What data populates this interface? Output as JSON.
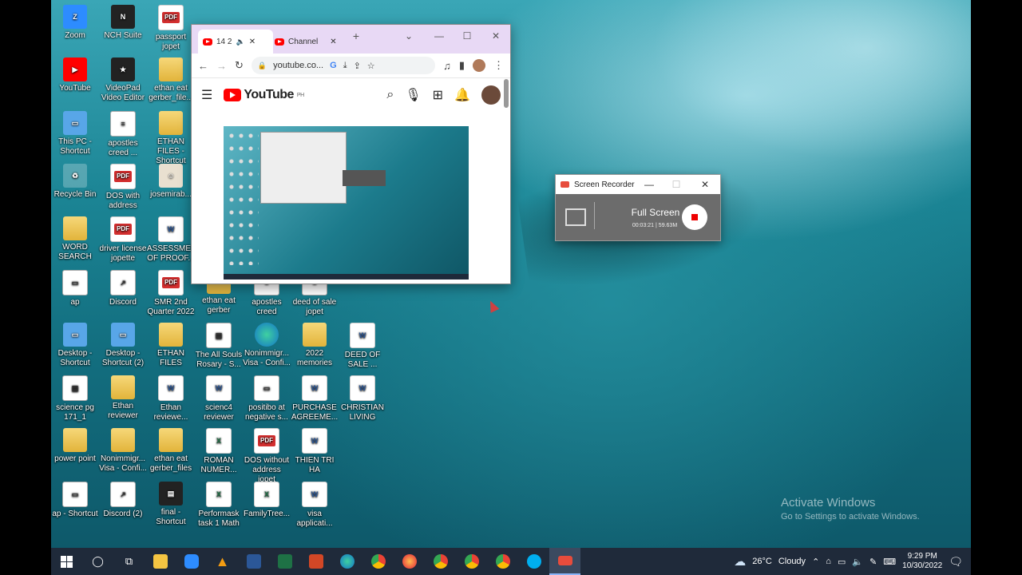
{
  "desktop": {
    "icons": [
      {
        "label": "Zoom",
        "x": 0,
        "y": 0,
        "type": "app",
        "glyph": "Z"
      },
      {
        "label": "NCH Suite",
        "x": 1,
        "y": 0,
        "type": "dark",
        "glyph": "N"
      },
      {
        "label": "passport jopet",
        "x": 2,
        "y": 0,
        "type": "pdf",
        "glyph": "PDF"
      },
      {
        "label": "YouTube",
        "x": 0,
        "y": 1,
        "type": "yt",
        "glyph": "▶"
      },
      {
        "label": "VideoPad Video Editor",
        "x": 1,
        "y": 1,
        "type": "dark",
        "glyph": "★"
      },
      {
        "label": "ethan eat gerber_file...",
        "x": 2,
        "y": 1,
        "type": "folder",
        "glyph": ""
      },
      {
        "label": "This PC - Shortcut",
        "x": 0,
        "y": 2,
        "type": "pc",
        "glyph": "▭"
      },
      {
        "label": "apostles creed ...",
        "x": 1,
        "y": 2,
        "type": "lnk",
        "glyph": "≡"
      },
      {
        "label": "ETHAN FILES - Shortcut",
        "x": 2,
        "y": 2,
        "type": "folder",
        "glyph": ""
      },
      {
        "label": "Recycle Bin",
        "x": 0,
        "y": 3,
        "type": "bin",
        "glyph": "♻"
      },
      {
        "label": "DOS with address",
        "x": 1,
        "y": 3,
        "type": "pdf",
        "glyph": "PDF"
      },
      {
        "label": "josemirab...",
        "x": 2,
        "y": 3,
        "type": "img",
        "glyph": "☺"
      },
      {
        "label": "WORD SEARCH",
        "x": 0,
        "y": 4,
        "type": "folder",
        "glyph": ""
      },
      {
        "label": "driver license jopette",
        "x": 1,
        "y": 4,
        "type": "pdf",
        "glyph": "PDF"
      },
      {
        "label": "ASSESSMENT OF PROOF...",
        "x": 2,
        "y": 4,
        "type": "word",
        "glyph": "W"
      },
      {
        "label": "ap",
        "x": 0,
        "y": 5,
        "type": "lnk",
        "glyph": "▭"
      },
      {
        "label": "Discord",
        "x": 1,
        "y": 5,
        "type": "lnk",
        "glyph": "↗"
      },
      {
        "label": "SMR 2nd Quarter 2022",
        "x": 2,
        "y": 5,
        "type": "pdf",
        "glyph": "PDF"
      },
      {
        "label": "ethan eat gerber",
        "x": 3,
        "y": 5,
        "type": "folder",
        "glyph": ""
      },
      {
        "label": "apostles creed",
        "x": 4,
        "y": 5,
        "type": "lnk",
        "glyph": "≡"
      },
      {
        "label": "deed of sale jopet",
        "x": 5,
        "y": 5,
        "type": "lnk",
        "glyph": "≡"
      },
      {
        "label": "Desktop - Shortcut",
        "x": 0,
        "y": 6,
        "type": "pc",
        "glyph": "▭"
      },
      {
        "label": "Desktop - Shortcut (2)",
        "x": 1,
        "y": 6,
        "type": "pc",
        "glyph": "▭"
      },
      {
        "label": "ETHAN FILES",
        "x": 2,
        "y": 6,
        "type": "folder",
        "glyph": ""
      },
      {
        "label": "The All Souls Rosary - S...",
        "x": 3,
        "y": 6,
        "type": "lnk",
        "glyph": "▤"
      },
      {
        "label": "Nonimmigr... Visa - Confi...",
        "x": 4,
        "y": 6,
        "type": "edge",
        "glyph": ""
      },
      {
        "label": "2022 memories",
        "x": 5,
        "y": 6,
        "type": "folder",
        "glyph": ""
      },
      {
        "label": "DEED OF SALE ...",
        "x": 6,
        "y": 6,
        "type": "word",
        "glyph": "W"
      },
      {
        "label": "science pg 171_1",
        "x": 0,
        "y": 7,
        "type": "lnk",
        "glyph": "▤"
      },
      {
        "label": "Ethan reviewer",
        "x": 1,
        "y": 7,
        "type": "folder",
        "glyph": ""
      },
      {
        "label": "Ethan reviewe...",
        "x": 2,
        "y": 7,
        "type": "word",
        "glyph": "W"
      },
      {
        "label": "scienc4 reviewer",
        "x": 3,
        "y": 7,
        "type": "word",
        "glyph": "W"
      },
      {
        "label": "positibo at negative s...",
        "x": 4,
        "y": 7,
        "type": "lnk",
        "glyph": "▭"
      },
      {
        "label": "PURCHASE AGREEME...",
        "x": 5,
        "y": 7,
        "type": "word",
        "glyph": "W"
      },
      {
        "label": "CHRISTIAN LIVING",
        "x": 6,
        "y": 7,
        "type": "word",
        "glyph": "W"
      },
      {
        "label": "power point",
        "x": 0,
        "y": 8,
        "type": "folder",
        "glyph": ""
      },
      {
        "label": "Nonimmigr... Visa - Confi...",
        "x": 1,
        "y": 8,
        "type": "folder",
        "glyph": ""
      },
      {
        "label": "ethan eat gerber_files",
        "x": 2,
        "y": 8,
        "type": "folder",
        "glyph": ""
      },
      {
        "label": "ROMAN NUMER...",
        "x": 3,
        "y": 8,
        "type": "excel",
        "glyph": "X"
      },
      {
        "label": "DOS without address jopet",
        "x": 4,
        "y": 8,
        "type": "pdf",
        "glyph": "PDF"
      },
      {
        "label": "THIEN TRI HA",
        "x": 5,
        "y": 8,
        "type": "word",
        "glyph": "W"
      },
      {
        "label": "ap - Shortcut",
        "x": 0,
        "y": 9,
        "type": "lnk",
        "glyph": "▭"
      },
      {
        "label": "Discord (2)",
        "x": 1,
        "y": 9,
        "type": "lnk",
        "glyph": "↗"
      },
      {
        "label": "final - Shortcut",
        "x": 2,
        "y": 9,
        "type": "dark",
        "glyph": "▤"
      },
      {
        "label": "Performask task 1 Math",
        "x": 3,
        "y": 9,
        "type": "excel",
        "glyph": "X"
      },
      {
        "label": "FamilyTree...",
        "x": 4,
        "y": 9,
        "type": "excel",
        "glyph": "X"
      },
      {
        "label": "visa applicati...",
        "x": 5,
        "y": 9,
        "type": "word",
        "glyph": "W"
      }
    ]
  },
  "browser": {
    "tabs": [
      {
        "label": "14 2",
        "active": true
      },
      {
        "label": "Channel",
        "active": false
      }
    ],
    "new_tab": "+",
    "window_controls": {
      "chevron": "⌄",
      "minimize": "—",
      "maximize": "☐",
      "close": "✕"
    },
    "address": "youtube.co...",
    "youtube": {
      "logo_text": "YouTube",
      "region": "PH"
    }
  },
  "recorder": {
    "title": "Screen Recorder",
    "mode": "Full Screen",
    "elapsed": "00:03:21",
    "size": "59.63M"
  },
  "watermark": {
    "line1": "Activate Windows",
    "line2": "Go to Settings to activate Windows."
  },
  "taskbar": {
    "weather_temp": "26°C",
    "weather_text": "Cloudy",
    "time": "9:29 PM",
    "date": "10/30/2022"
  }
}
